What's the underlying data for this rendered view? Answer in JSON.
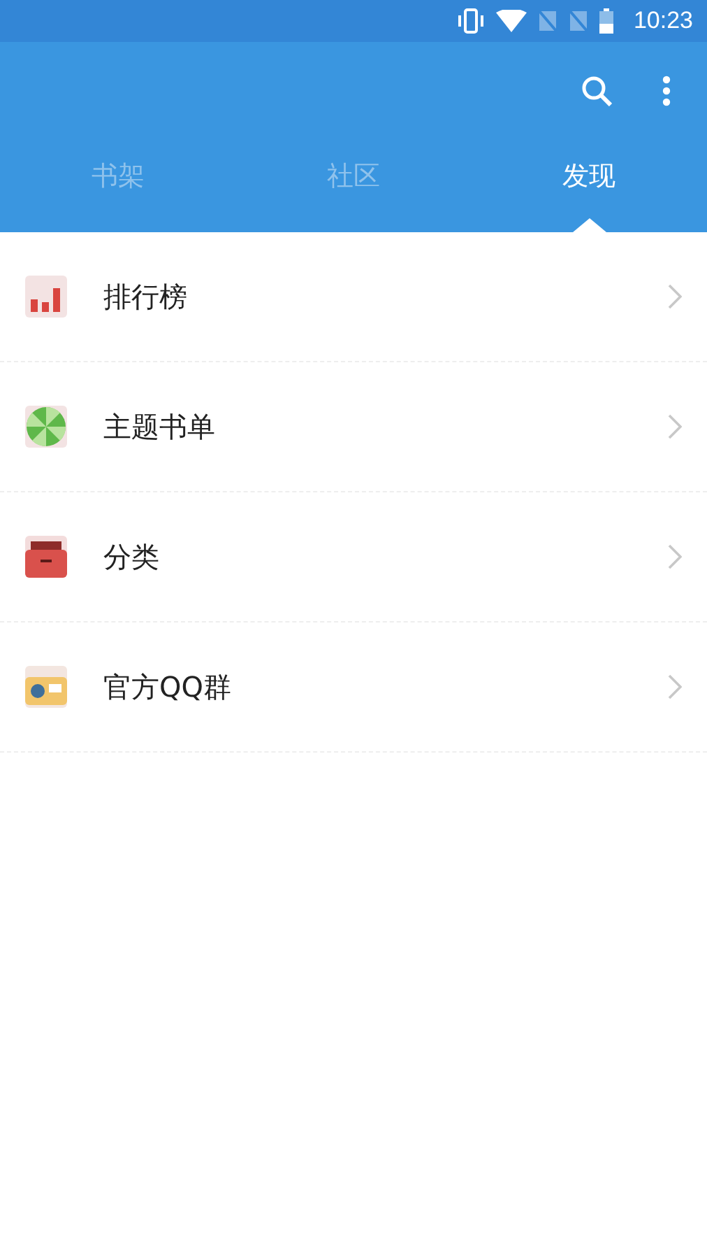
{
  "status_bar": {
    "time": "10:23"
  },
  "tabs": [
    {
      "label": "书架",
      "selected": false
    },
    {
      "label": "社区",
      "selected": false
    },
    {
      "label": "发现",
      "selected": true
    }
  ],
  "items": [
    {
      "label": "排行榜",
      "kind": "chart"
    },
    {
      "label": "主题书单",
      "kind": "candy"
    },
    {
      "label": "分类",
      "kind": "drawer"
    },
    {
      "label": "官方QQ群",
      "kind": "radio"
    }
  ]
}
